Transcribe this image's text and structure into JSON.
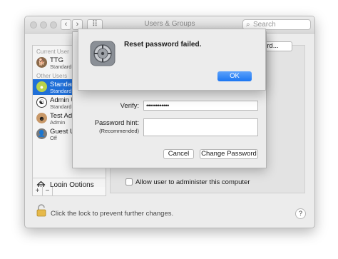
{
  "window": {
    "title": "Users & Groups",
    "search_placeholder": "Search",
    "back_glyph": "‹",
    "forward_glyph": "›",
    "grid_glyph": "⠿"
  },
  "sidebar": {
    "current_user_header": "Current User",
    "other_users_header": "Other Users",
    "current_user": {
      "name": "TTG",
      "role": "Standard",
      "avatar_icon": "dog-avatar-icon"
    },
    "other_users": [
      {
        "name": "Standard",
        "role": "Standard",
        "selected": true,
        "avatar_icon": "tennis-ball-avatar-icon"
      },
      {
        "name": "Admin U",
        "role": "Standard",
        "avatar_icon": "yin-yang-avatar-icon"
      },
      {
        "name": "Test Adr",
        "role": "Admin",
        "avatar_icon": "face-avatar-icon"
      },
      {
        "name": "Guest U",
        "role": "Off",
        "avatar_icon": "guest-avatar-icon"
      }
    ],
    "login_options_label": "Login Options",
    "add_label": "+",
    "remove_label": "−"
  },
  "content": {
    "change_password_button_partial": "assword...",
    "admin_checkbox_label": "Allow user to administer this computer",
    "admin_checked": false
  },
  "footer": {
    "lock_text": "Click the lock to prevent further changes.",
    "help_label": "?"
  },
  "sheet": {
    "verify_label": "Verify:",
    "verify_value": "••••••••••••",
    "hint_label": "Password hint:",
    "hint_sublabel": "(Recommended)",
    "cancel_label": "Cancel",
    "change_label": "Change Password"
  },
  "alert": {
    "title": "Reset password failed.",
    "ok_label": "OK"
  },
  "colors": {
    "accent": "#1f6fd8",
    "ok_button": "#1c76f2"
  }
}
